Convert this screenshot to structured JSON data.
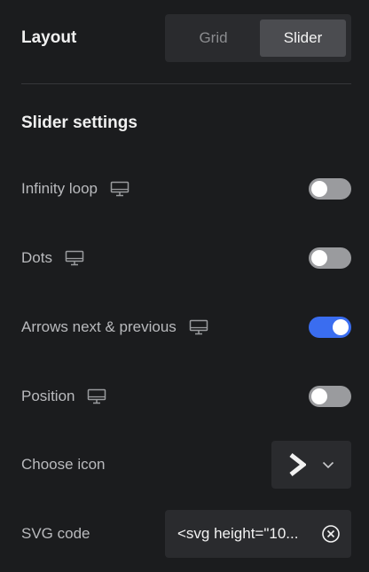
{
  "layout": {
    "title": "Layout",
    "options": [
      "Grid",
      "Slider"
    ],
    "selected": "Slider"
  },
  "slider_settings": {
    "title": "Slider settings",
    "infinity_loop": {
      "label": "Infinity loop",
      "enabled": false
    },
    "dots": {
      "label": "Dots",
      "enabled": false
    },
    "arrows": {
      "label": "Arrows next & previous",
      "enabled": true
    },
    "position": {
      "label": "Position",
      "enabled": false
    },
    "choose_icon": {
      "label": "Choose icon",
      "icon": "chevron-right-icon"
    },
    "svg_code": {
      "label": "SVG code",
      "value": "<svg height=\"10..."
    }
  },
  "colors": {
    "background": "#1b1c1e",
    "toggle_on": "#3a6df0",
    "toggle_off": "#9a9b9e"
  }
}
